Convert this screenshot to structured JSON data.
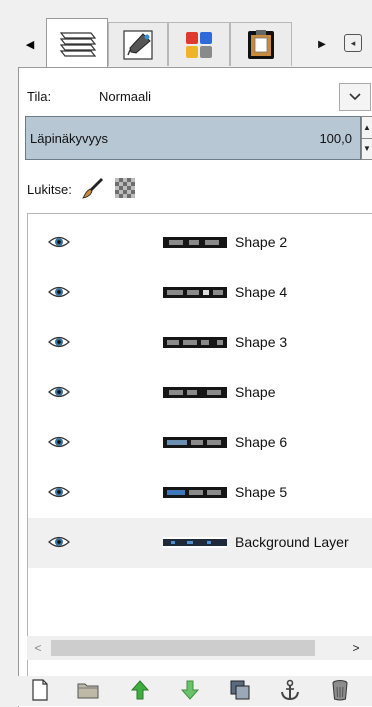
{
  "tabs": {
    "prev_arrow": "◀",
    "next_arrow": "▶",
    "menu_glyph": "◂",
    "items": [
      {
        "name": "layers",
        "icon": "layers-icon",
        "active": true
      },
      {
        "name": "paths",
        "icon": "paths-icon",
        "active": false
      },
      {
        "name": "palette",
        "icon": "palette-icon",
        "active": false
      },
      {
        "name": "clipboard",
        "icon": "clipboard-icon",
        "active": false
      }
    ]
  },
  "mode": {
    "label": "Tila:",
    "value": "Normaali"
  },
  "opacity": {
    "label": "Läpinäkyvyys",
    "value": "100,0"
  },
  "lock": {
    "label": "Lukitse:"
  },
  "layers": [
    {
      "name": "Shape 2",
      "visible": true,
      "selected": false
    },
    {
      "name": "Shape 4",
      "visible": true,
      "selected": false
    },
    {
      "name": "Shape 3",
      "visible": true,
      "selected": false
    },
    {
      "name": "Shape",
      "visible": true,
      "selected": false
    },
    {
      "name": "Shape 6",
      "visible": true,
      "selected": false
    },
    {
      "name": "Shape 5",
      "visible": true,
      "selected": false
    },
    {
      "name": "Background Layer",
      "visible": true,
      "selected": true
    }
  ],
  "scrollbar": {
    "left_arrow": "<",
    "right_arrow": ">"
  },
  "toolbar": [
    {
      "name": "new-layer",
      "icon": "new-layer-icon"
    },
    {
      "name": "new-group",
      "icon": "folder-icon"
    },
    {
      "name": "raise-layer",
      "icon": "arrow-up-icon"
    },
    {
      "name": "lower-layer",
      "icon": "arrow-down-icon"
    },
    {
      "name": "duplicate-layer",
      "icon": "duplicate-icon"
    },
    {
      "name": "anchor-layer",
      "icon": "anchor-icon"
    },
    {
      "name": "delete-layer",
      "icon": "trash-icon"
    }
  ],
  "colors": {
    "opacity_bg": "#b8c7d4",
    "arrow_green": "#3fae3f",
    "palette_red": "#e03a2e",
    "palette_blue": "#2f6bd8",
    "palette_yellow": "#f0b429",
    "palette_gray": "#8a8a8a"
  }
}
